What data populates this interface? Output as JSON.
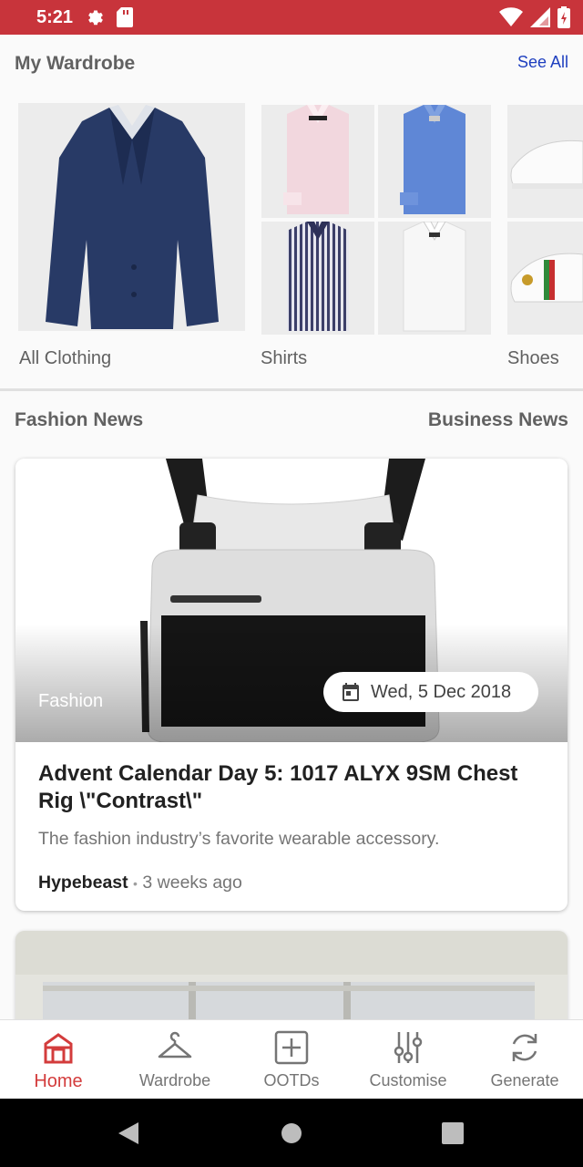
{
  "status_bar": {
    "time": "5:21"
  },
  "wardrobe": {
    "title": "My Wardrobe",
    "see_all": "See All",
    "categories": [
      {
        "label": "All Clothing"
      },
      {
        "label": "Shirts"
      },
      {
        "label": "Shoes"
      }
    ]
  },
  "news_tabs": {
    "fashion": "Fashion News",
    "business": "Business News"
  },
  "article": {
    "category": "Fashion",
    "date": "Wed, 5 Dec 2018",
    "title": "Advent Calendar Day 5: 1017 ALYX 9SM Chest Rig \\\"Contrast\\\"",
    "description": "The fashion industry’s favorite wearable accessory.",
    "source": "Hypebeast",
    "separator": "•",
    "time_ago": "3 weeks ago"
  },
  "bottom_nav": [
    {
      "label": "Home",
      "icon": "home-icon",
      "active": true
    },
    {
      "label": "Wardrobe",
      "icon": "hanger-icon",
      "active": false
    },
    {
      "label": "OOTDs",
      "icon": "add-box-icon",
      "active": false
    },
    {
      "label": "Customise",
      "icon": "sliders-icon",
      "active": false
    },
    {
      "label": "Generate",
      "icon": "refresh-icon",
      "active": false
    }
  ],
  "colors": {
    "accent": "#c8343b",
    "link": "#1e3fbf",
    "active_tab": "#d33c3c"
  }
}
